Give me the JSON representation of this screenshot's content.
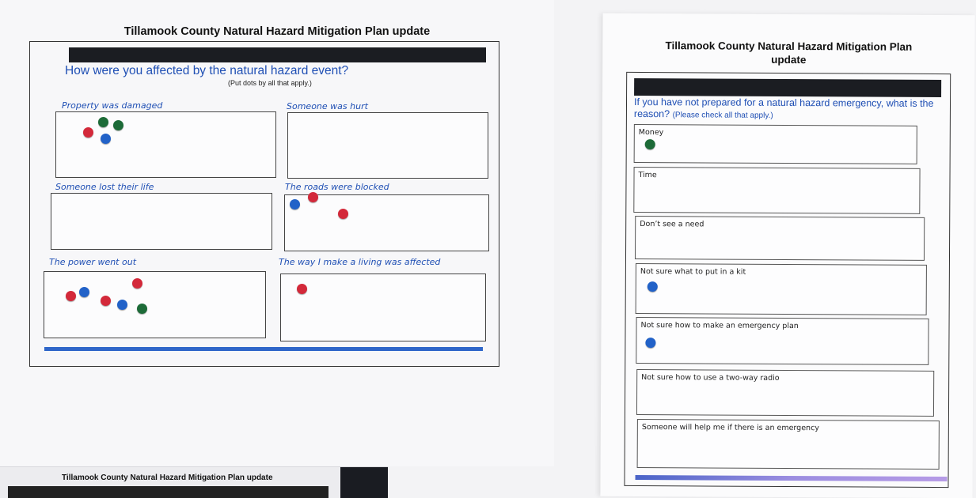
{
  "left_sheet": {
    "title": "Tillamook County Natural Hazard Mitigation Plan update",
    "question": "How were you affected by the natural hazard event?",
    "instruction": "(Put dots by all that apply.)",
    "categories": [
      {
        "label": "Property was damaged",
        "dots": [
          "red",
          "green",
          "green",
          "blue"
        ]
      },
      {
        "label": "Someone was hurt",
        "dots": []
      },
      {
        "label": "Someone lost their life",
        "dots": []
      },
      {
        "label": "The roads were blocked",
        "dots": [
          "blue",
          "red",
          "red"
        ]
      },
      {
        "label": "The power went out",
        "dots": [
          "red",
          "blue",
          "red",
          "red",
          "blue",
          "green"
        ]
      },
      {
        "label": "The way I make a living was affected",
        "dots": [
          "red"
        ]
      }
    ]
  },
  "right_sheet": {
    "title": "Tillamook County Natural Hazard Mitigation Plan update",
    "question": "If you have not prepared for a natural hazard emergency, what is the reason?",
    "instruction": "(Please check all that apply.)",
    "options": [
      {
        "label": "Money",
        "dots": [
          "green"
        ]
      },
      {
        "label": "Time",
        "dots": []
      },
      {
        "label": "Don’t see a need",
        "dots": []
      },
      {
        "label": "Not sure what to put in a kit",
        "dots": [
          "blue"
        ]
      },
      {
        "label": "Not sure how to make an emergency plan",
        "dots": [
          "blue"
        ]
      },
      {
        "label": "Not sure how to use a two-way radio",
        "dots": []
      },
      {
        "label": "Someone will help me if there is an emergency",
        "dots": []
      }
    ]
  },
  "bottom_sheet": {
    "title": "Tillamook County Natural Hazard Mitigation Plan update"
  },
  "colors": {
    "red": "#d3293a",
    "blue": "#2262c8",
    "green": "#1d6b38",
    "accent_text": "#1f4fb4"
  }
}
